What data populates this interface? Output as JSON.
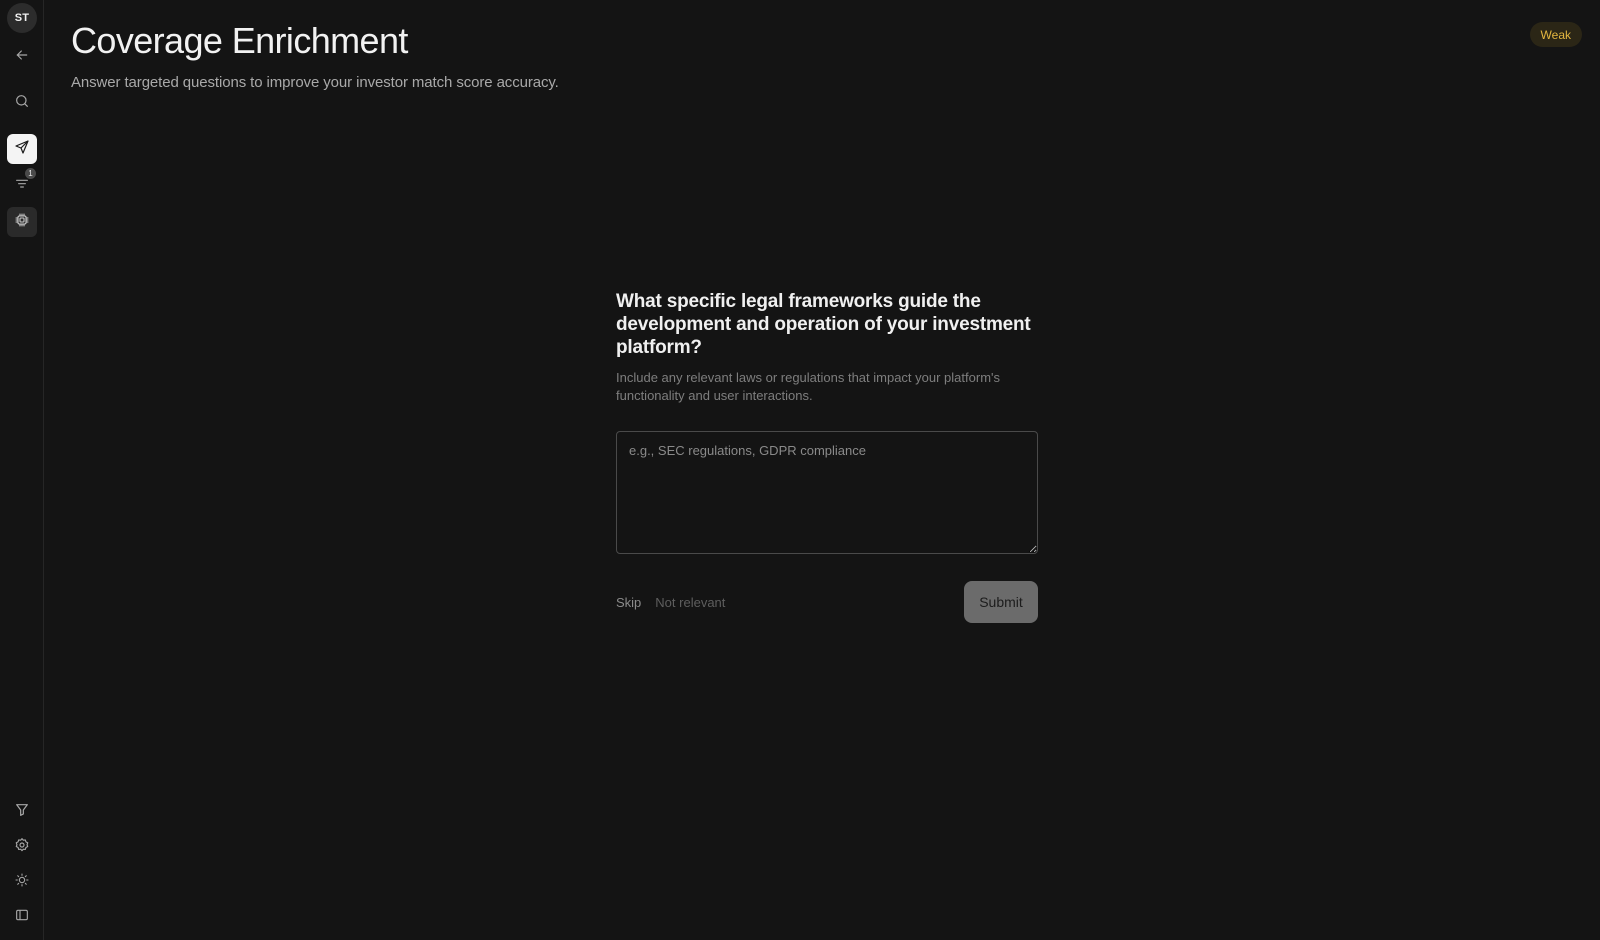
{
  "user": {
    "initials": "ST"
  },
  "sidebar": {
    "top_items": [
      {
        "icon": "arrow-left-icon",
        "label": "Back"
      },
      {
        "icon": "search-icon",
        "label": "Search"
      },
      {
        "icon": "send-icon",
        "label": "Outreach"
      },
      {
        "icon": "list-filter-icon",
        "label": "Queue",
        "badge": "1"
      },
      {
        "icon": "chip-icon",
        "label": "Enrichment"
      }
    ],
    "bottom_items": [
      {
        "icon": "filter-icon",
        "label": "Filters"
      },
      {
        "icon": "gear-icon",
        "label": "Settings"
      },
      {
        "icon": "sun-icon",
        "label": "Theme"
      },
      {
        "icon": "sidebar-toggle-icon",
        "label": "Toggle sidebar"
      }
    ]
  },
  "header": {
    "title": "Coverage Enrichment",
    "subtitle": "Answer targeted questions to improve your investor match score accuracy.",
    "strength_badge": "Weak"
  },
  "question": {
    "text": "What specific legal frameworks guide the development and operation of your investment platform?",
    "hint": "Include any relevant laws or regulations that impact your platform's functionality and user interactions.",
    "answer_value": "",
    "answer_placeholder": "e.g., SEC regulations, GDPR compliance"
  },
  "actions": {
    "skip_label": "Skip",
    "not_relevant_label": "Not relevant",
    "submit_label": "Submit"
  },
  "colors": {
    "background": "#141414",
    "badge_text": "#e3b63f",
    "badge_bg": "#2b2616",
    "submit_bg": "#6b6b6b"
  }
}
